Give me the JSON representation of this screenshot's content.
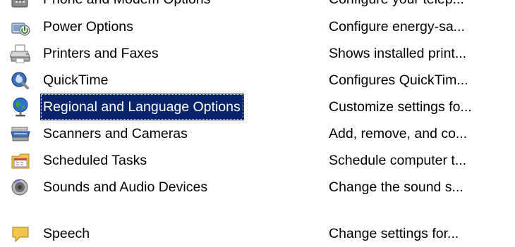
{
  "items": [
    {
      "name": "Phone and Modem Options",
      "description": "Configure your telep...",
      "icon": "phone-modem-icon",
      "selected": false
    },
    {
      "name": "Power Options",
      "description": "Configure energy-sa...",
      "icon": "power-options-icon",
      "selected": false
    },
    {
      "name": "Printers and Faxes",
      "description": "Shows installed print...",
      "icon": "printer-icon",
      "selected": false
    },
    {
      "name": "QuickTime",
      "description": "Configures QuickTim...",
      "icon": "quicktime-icon",
      "selected": false
    },
    {
      "name": "Regional and Language Options",
      "description": "Customize settings fo...",
      "icon": "globe-icon",
      "selected": true
    },
    {
      "name": "Scanners and Cameras",
      "description": "Add, remove, and co...",
      "icon": "scanner-icon",
      "selected": false
    },
    {
      "name": "Scheduled Tasks",
      "description": "Schedule computer t...",
      "icon": "scheduled-tasks-icon",
      "selected": false
    },
    {
      "name": "Sounds and Audio Devices",
      "description": "Change the sound s...",
      "icon": "speaker-icon",
      "selected": false
    },
    {
      "name": "Speech",
      "description": "Change settings for...",
      "icon": "speech-icon",
      "selected": false
    }
  ],
  "colors": {
    "selection_background": "#0a246a",
    "selection_text": "#ffffff",
    "window_background": "#ffffff"
  }
}
